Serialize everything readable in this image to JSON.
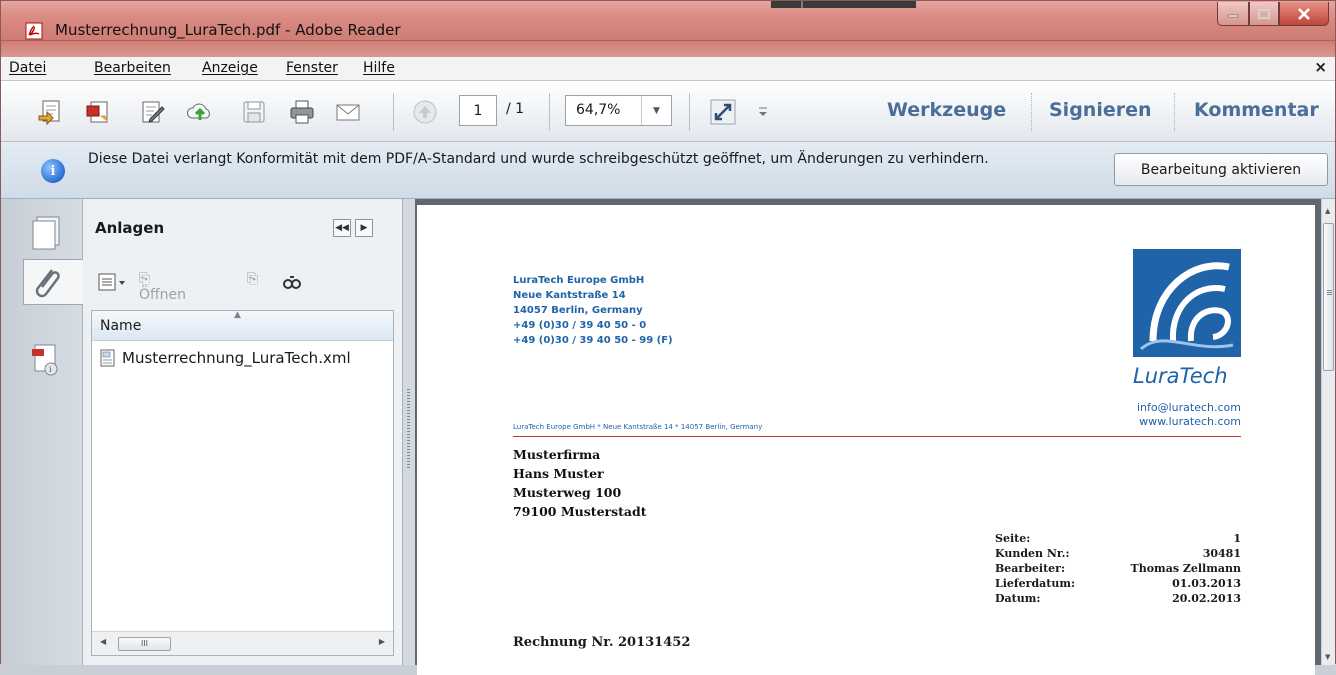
{
  "window": {
    "title": "Musterrechnung_LuraTech.pdf - Adobe Reader",
    "menu_close": "×"
  },
  "menu": {
    "items": [
      {
        "label": "Datei"
      },
      {
        "label": "Bearbeiten"
      },
      {
        "label": "Anzeige"
      },
      {
        "label": "Fenster"
      },
      {
        "label": "Hilfe"
      }
    ]
  },
  "toolbar": {
    "page_current": "1",
    "page_total": "/ 1",
    "zoom": "64,7%",
    "links": [
      "Werkzeuge",
      "Signieren",
      "Kommentar"
    ]
  },
  "infobar": {
    "message": "Diese Datei verlangt Konformität mit dem PDF/A-Standard und wurde schreibgeschützt geöffnet, um Änderungen zu verhindern.",
    "button": "Bearbeitung aktivieren"
  },
  "panel": {
    "title": "Anlagen",
    "open_label": "Öffnen",
    "column_name": "Name",
    "files": [
      {
        "name": "Musterrechnung_LuraTech.xml"
      }
    ],
    "scroll_thumb": "III"
  },
  "document": {
    "sender": [
      "LuraTech Europe GmbH",
      "Neue Kantstraße 14",
      "14057 Berlin, Germany",
      "+49 (0)30 / 39 40 50 - 0",
      "+49 (0)30 / 39 40 50 - 99 (F)"
    ],
    "logo_text": "LuraTech",
    "contact": [
      "info@luratech.com",
      "www.luratech.com"
    ],
    "return_address": "LuraTech Europe GmbH * Neue Kantstraße 14 * 14057 Berlin, Germany",
    "recipient": [
      "Musterfirma",
      "Hans Muster",
      "Musterweg 100",
      "79100 Musterstadt"
    ],
    "meta": [
      {
        "label": "Seite:",
        "value": "1"
      },
      {
        "label": "Kunden Nr.:",
        "value": "30481"
      },
      {
        "label": "Bearbeiter:",
        "value": "Thomas Zellmann"
      },
      {
        "label": "Lieferdatum:",
        "value": "01.03.2013"
      },
      {
        "label": "Datum:",
        "value": "20.02.2013"
      }
    ],
    "invoice_title": "Rechnung Nr. 20131452"
  },
  "colors": {
    "title_bar": "#d98a82",
    "link": "#4a6e97",
    "brand_blue": "#1f63a8",
    "rule_red": "#c0392b"
  },
  "icons": {
    "title": "pdf-icon",
    "toolbar": [
      "create-pdf-icon",
      "convert-pdf-icon",
      "edit-pdf-icon",
      "cloud-upload-icon",
      "save-icon",
      "print-icon",
      "email-icon",
      "previous-page-icon",
      "fit-window-icon",
      "more-tools-icon"
    ],
    "nav": [
      "pages-icon",
      "attachments-icon",
      "document-properties-icon"
    ],
    "panel": [
      "options-icon",
      "open-icon",
      "save-attachment-icon",
      "find-icon",
      "xml-file-icon"
    ]
  }
}
